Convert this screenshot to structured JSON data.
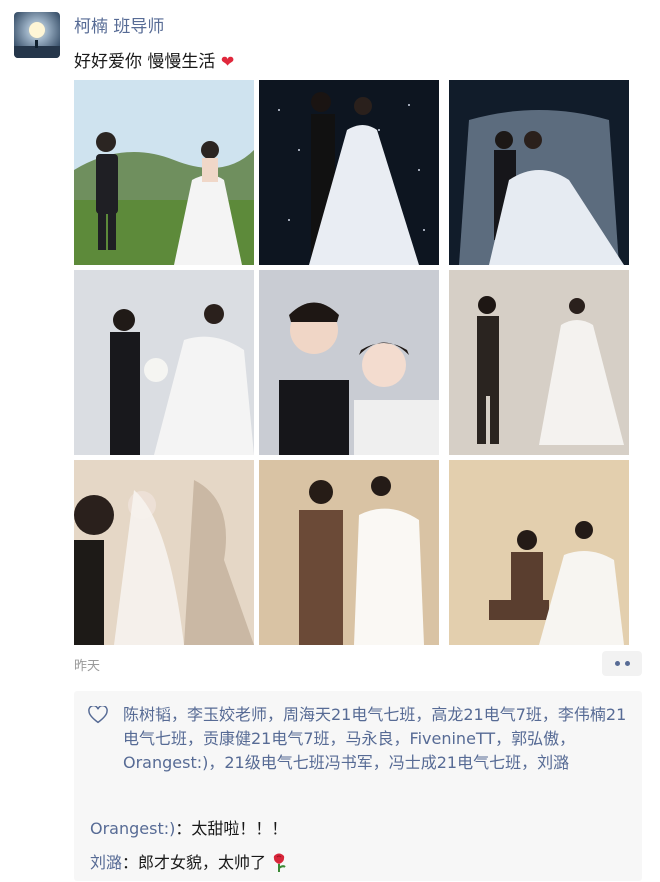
{
  "post": {
    "author": "柯楠 班导师",
    "text": "好好爱你 慢慢生活",
    "emoji_icon": "red-heart-icon",
    "time": "昨天",
    "photos": [
      {
        "name": "photo-couple-lawn"
      },
      {
        "name": "photo-couple-starry"
      },
      {
        "name": "photo-couple-veil"
      },
      {
        "name": "photo-couple-bouquet"
      },
      {
        "name": "photo-couple-closeup"
      },
      {
        "name": "photo-couple-dance"
      },
      {
        "name": "photo-couple-shadow"
      },
      {
        "name": "photo-couple-suit"
      },
      {
        "name": "photo-couple-seated"
      }
    ]
  },
  "likes": {
    "icon": "heart-outline-icon",
    "names": "陈树韬，李玉姣老师，周海天21电气七班，高龙21电气7班，李伟楠21电气七班，贡康健21电气7班，马永良，FivenineTT，郭弘傲，Orangest:)，21级电气七班冯书军，冯士成21电气七班，刘潞"
  },
  "comments": [
    {
      "author": "Orangest:)",
      "sep": "：",
      "text": "太甜啦！！！",
      "emoji_icon": ""
    },
    {
      "author": "刘潞",
      "sep": "：",
      "text": "郎才女貌，太帅了",
      "emoji_icon": "rose-icon"
    }
  ],
  "colors": {
    "link": "#576b95",
    "heart": "#e0283c",
    "panel": "#f7f7f7"
  }
}
